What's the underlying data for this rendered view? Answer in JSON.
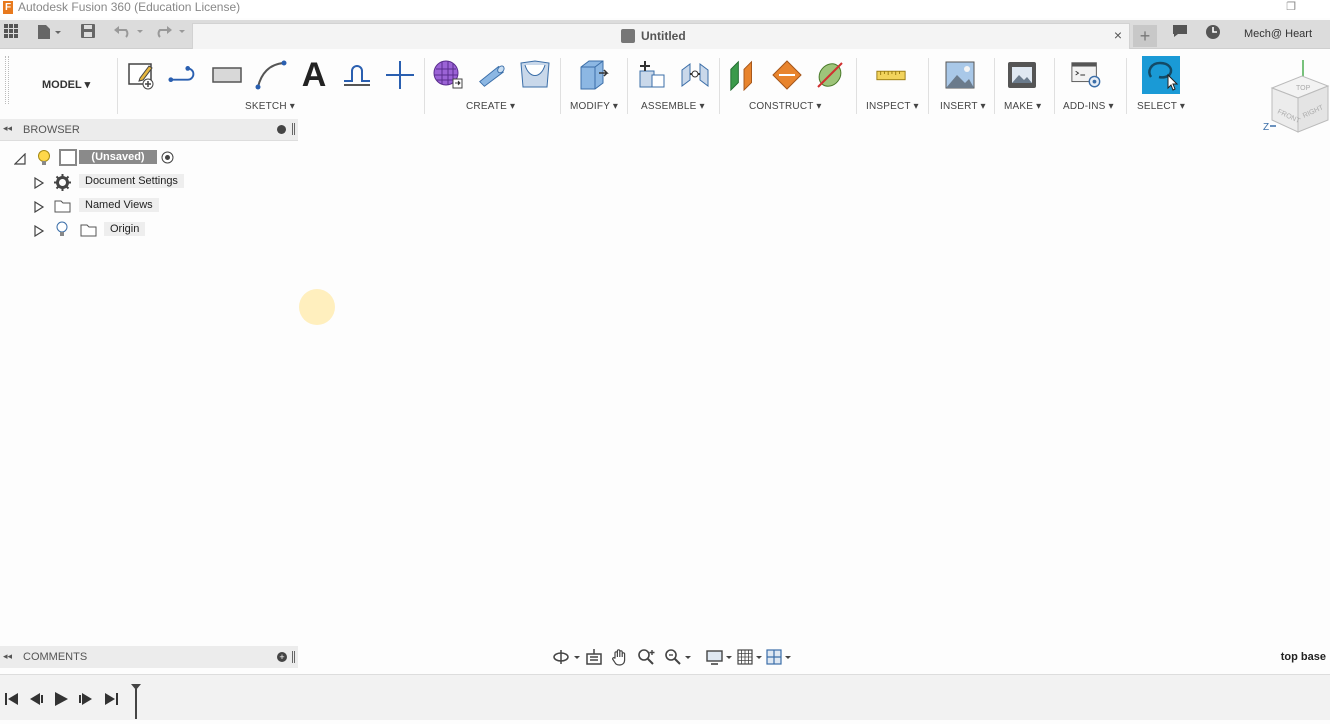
{
  "window": {
    "title": "Autodesk Fusion 360 (Education License)",
    "logo_letter": "F"
  },
  "document": {
    "tab_name": "Untitled",
    "close": "×",
    "new_tab": "+"
  },
  "user": {
    "name": "Mech@ Heart"
  },
  "workspace": {
    "label": "MODEL ▾"
  },
  "toolbar": {
    "groups": [
      {
        "label": "SKETCH ▾"
      },
      {
        "label": "CREATE ▾"
      },
      {
        "label": "MODIFY ▾"
      },
      {
        "label": "ASSEMBLE ▾"
      },
      {
        "label": "CONSTRUCT ▾"
      },
      {
        "label": "INSPECT ▾"
      },
      {
        "label": "INSERT ▾"
      },
      {
        "label": "MAKE ▾"
      },
      {
        "label": "ADD-INS ▾"
      },
      {
        "label": "SELECT ▾"
      }
    ],
    "text_tool_glyph": "A"
  },
  "browser": {
    "header": "BROWSER",
    "arrows": "◂◂",
    "root": "(Unsaved)",
    "items": [
      {
        "label": "Document Settings",
        "icon": "gear-icon"
      },
      {
        "label": "Named Views",
        "icon": "folder-icon"
      },
      {
        "label": "Origin",
        "icon": "folder-icon"
      }
    ]
  },
  "comments": {
    "header": "COMMENTS",
    "arrows": "◂◂",
    "plus": "+"
  },
  "status": {
    "right_text": "top base"
  },
  "colors": {
    "accent_select": "#1a9ad6",
    "root_label_bg": "#8a8a8a"
  }
}
